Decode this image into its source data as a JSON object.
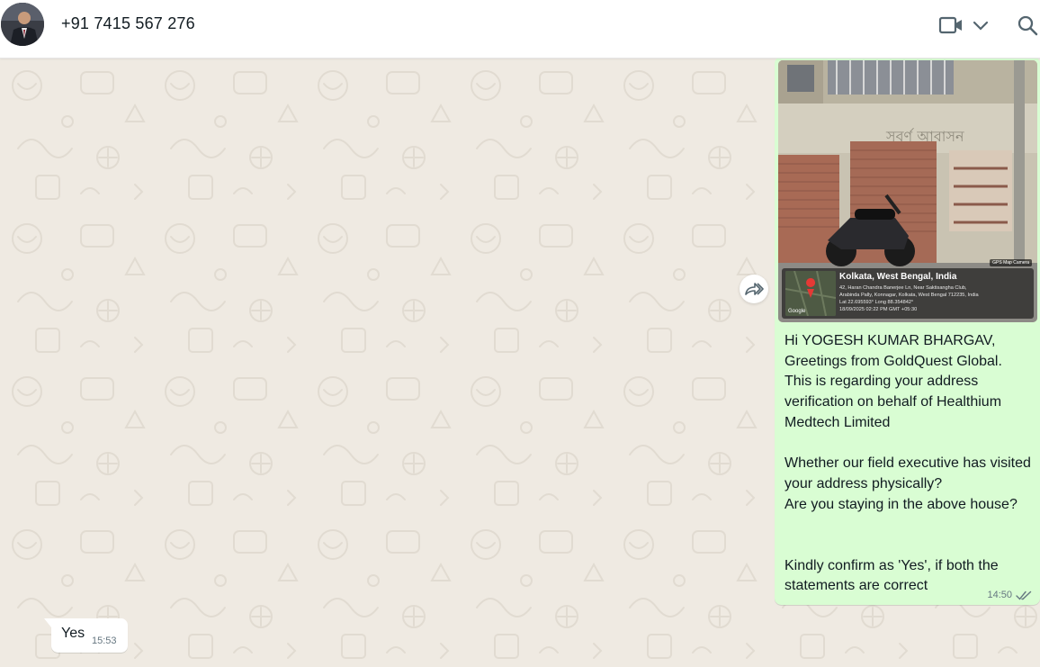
{
  "header": {
    "contact_name": "+91 7415 567 276",
    "avatar_icon": "profile-photo",
    "video_call_icon": "video-camera-icon",
    "dropdown_icon": "chevron-down-icon",
    "search_icon": "search-icon"
  },
  "messages": {
    "outgoing": {
      "photo": {
        "location_city": "Kolkata, West Bengal, India",
        "address_line1": "42, Haran Chandra Banerjee Ln, Near Saktisangha Club,",
        "address_line2": "Arabinda Pally, Konnagar, Kolkata, West Bengal 712235, India",
        "latlong": "Lat 22.695593° Long 88.354842°",
        "datetime": "18/09/2025 02:22 PM GMT +05:30",
        "app_tag": "GPS Map Camera",
        "map_brand": "Google",
        "signboard": "সুবর্ণ আবাসন"
      },
      "text": "Hi YOGESH KUMAR BHARGAV,\nGreetings from GoldQuest Global.\nThis is regarding your address verification on behalf of Healthium Medtech Limited\n\nWhether our field executive has visited your address physically?\nAre you staying in the above house?\n\n\nKindly confirm as 'Yes', if both the statements are correct",
      "time": "14:50",
      "status_icon": "double-check-icon"
    },
    "incoming": {
      "text": "Yes",
      "time": "15:53"
    }
  },
  "forward_icon": "forward-icon",
  "colors": {
    "chat_bg": "#efeae2",
    "outgoing_bubble": "#d9fdd3",
    "incoming_bubble": "#ffffff",
    "meta_text": "#667781"
  }
}
